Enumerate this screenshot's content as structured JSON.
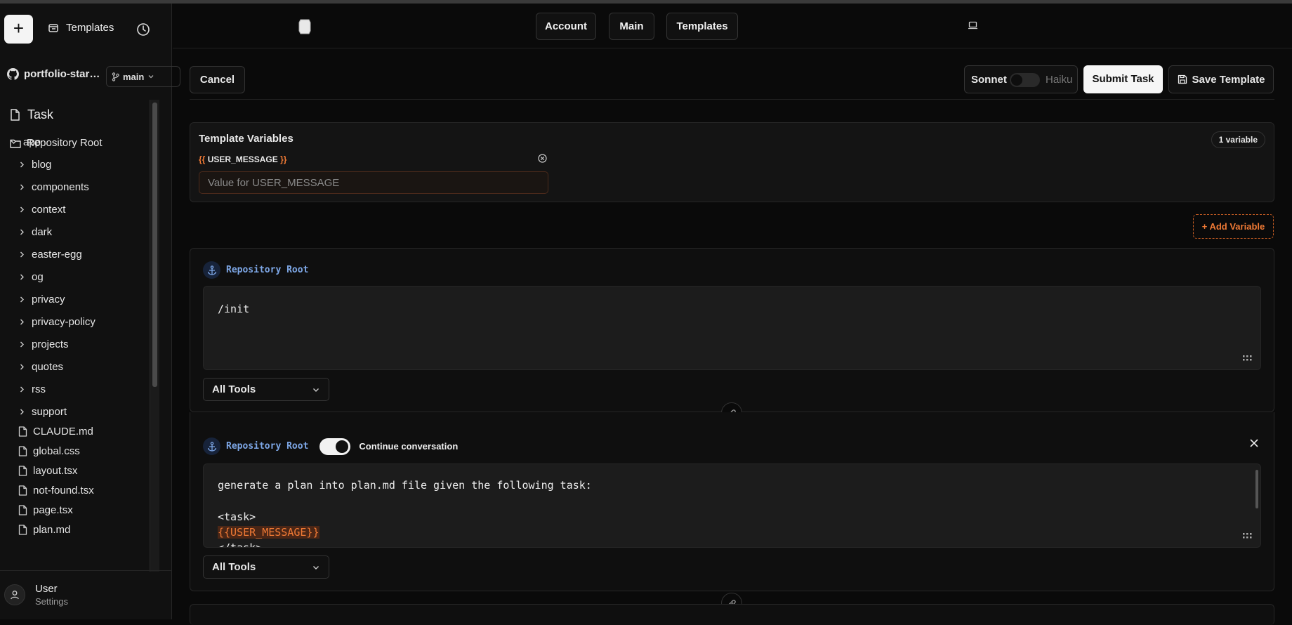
{
  "sidebar": {
    "new_label": "+",
    "templates_label": "Templates",
    "repo_name": "portfolio-starter-kit",
    "branch": "main",
    "task_label": "Task",
    "root_label": "Repository Root",
    "tree": [
      {
        "label": "app",
        "kind": "folder-open",
        "depth": 0
      },
      {
        "label": "blog",
        "kind": "folder",
        "depth": 1
      },
      {
        "label": "components",
        "kind": "folder",
        "depth": 1
      },
      {
        "label": "context",
        "kind": "folder",
        "depth": 1
      },
      {
        "label": "dark",
        "kind": "folder",
        "depth": 1
      },
      {
        "label": "easter-egg",
        "kind": "folder",
        "depth": 1
      },
      {
        "label": "og",
        "kind": "folder",
        "depth": 1
      },
      {
        "label": "privacy",
        "kind": "folder",
        "depth": 1
      },
      {
        "label": "privacy-policy",
        "kind": "folder",
        "depth": 1
      },
      {
        "label": "projects",
        "kind": "folder",
        "depth": 1
      },
      {
        "label": "quotes",
        "kind": "folder",
        "depth": 1
      },
      {
        "label": "rss",
        "kind": "folder",
        "depth": 1
      },
      {
        "label": "support",
        "kind": "folder",
        "depth": 1
      },
      {
        "label": "CLAUDE.md",
        "kind": "file",
        "depth": 1
      },
      {
        "label": "global.css",
        "kind": "file",
        "depth": 1
      },
      {
        "label": "layout.tsx",
        "kind": "file",
        "depth": 1
      },
      {
        "label": "not-found.tsx",
        "kind": "file",
        "depth": 1
      },
      {
        "label": "page.tsx",
        "kind": "file",
        "depth": 1
      },
      {
        "label": "plan.md",
        "kind": "file",
        "depth": 1
      }
    ],
    "user_name": "User",
    "user_sub": "Settings"
  },
  "header": {
    "nav": [
      "Account",
      "Main",
      "Templates"
    ]
  },
  "toolbar": {
    "cancel": "Cancel",
    "model_a": "Sonnet",
    "model_b": "Haiku",
    "submit": "Submit Task",
    "save_template": "Save Template"
  },
  "template_vars": {
    "title": "Template Variables",
    "count": "1 variable",
    "open_brace": "{{",
    "close_brace": "}}",
    "var_name": "USER_MESSAGE",
    "input_placeholder": "Value for USER_MESSAGE",
    "input_value": "",
    "add_variable": "+ Add Variable"
  },
  "steps": [
    {
      "directory": "Repository Root",
      "lines": [
        "/init"
      ],
      "tools": "All Tools"
    },
    {
      "directory": "Repository Root",
      "continue_label": "Continue conversation",
      "lines": [
        "generate a plan into plan.md file given the following task:",
        "",
        "<task>",
        "{{USER_MESSAGE}}",
        "</task>"
      ],
      "tools": "All Tools"
    }
  ],
  "colors": {
    "accent_orange": "#f07a35",
    "dir_blue": "#7ea8e8",
    "background": "#0a0a0a"
  }
}
